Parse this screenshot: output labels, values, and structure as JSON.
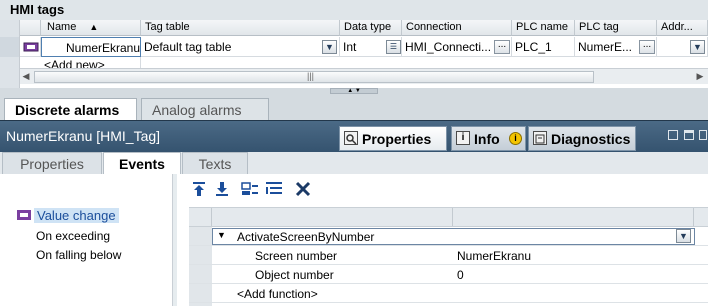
{
  "hmi_tags": {
    "title": "HMI tags",
    "columns": [
      "Name",
      "Tag table",
      "Data type",
      "Connection",
      "PLC name",
      "PLC tag",
      "Addr..."
    ],
    "sort_indicator": "▲",
    "row": {
      "name": "NumerEkranu",
      "tag_table": "Default tag table",
      "data_type": "Int",
      "connection": "HMI_Connecti...",
      "plc_name": "PLC_1",
      "plc_tag": "NumerE..."
    },
    "add_new": "<Add new>",
    "scroll_grip": "|||"
  },
  "alarm_tabs": [
    "Discrete alarms",
    "Analog alarms"
  ],
  "inspector": {
    "object_title": "NumerEkranu [HMI_Tag]",
    "tabs": {
      "properties": "Properties",
      "info": "Info",
      "diagnostics": "Diagnostics"
    },
    "info_badge": "i"
  },
  "sub_tabs": [
    "Properties",
    "Events",
    "Texts"
  ],
  "events": {
    "items": [
      "Value change",
      "On exceeding",
      "On falling below"
    ],
    "selected": "Value change"
  },
  "function_list": {
    "function_name": "ActivateScreenByNumber",
    "params": [
      {
        "name": "Screen number",
        "value": "NumerEkranu"
      },
      {
        "name": "Object number",
        "value": "0"
      }
    ],
    "add_function": "<Add function>"
  },
  "colors": {
    "accent_blue": "#1b4e9b",
    "inspector_bar": "#3b5a76",
    "selection": "#cfe3f5"
  }
}
